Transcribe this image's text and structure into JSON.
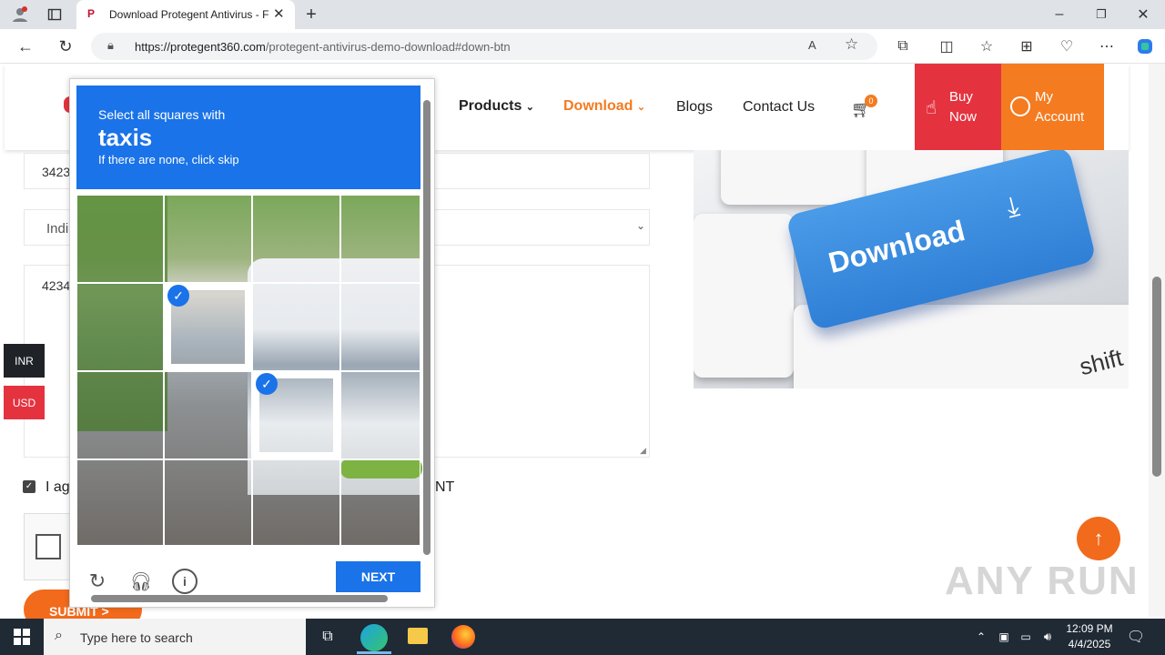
{
  "browser": {
    "tab_title": "Download Protegent Antivirus - F",
    "tab_favicon": "P",
    "url_host": "https://protegent360.com",
    "url_path": "/protegent-antivirus-demo-download#down-btn"
  },
  "nav": {
    "products": "Products",
    "download": "Download",
    "blogs": "Blogs",
    "contact": "Contact Us",
    "cart_count": "0",
    "buy_now_1": "Buy",
    "buy_now_2": "Now",
    "my_account_1": "My",
    "my_account_2": "Account"
  },
  "form": {
    "field1_value": "3423",
    "field2_value": "Indi",
    "field3_value": "4234",
    "agree_text": "I ag",
    "agree_tail": "NT",
    "submit_label": "SUBMIT >"
  },
  "currency": {
    "inr": "INR",
    "usd": "USD"
  },
  "image": {
    "key_text": "Download",
    "shift_text": "shift"
  },
  "captcha": {
    "instruction": "Select all squares with",
    "target": "taxis",
    "hint": "If there are none, click skip",
    "next_label": "NEXT",
    "selected_cells": [
      4,
      9
    ]
  },
  "watermark": "ANY RUN",
  "taskbar": {
    "search_placeholder": "Type here to search",
    "time": "12:09 PM",
    "date": "4/4/2025"
  },
  "colors": {
    "accent_orange": "#f47b20",
    "accent_red": "#e4333f",
    "captcha_blue": "#1a73e8"
  }
}
